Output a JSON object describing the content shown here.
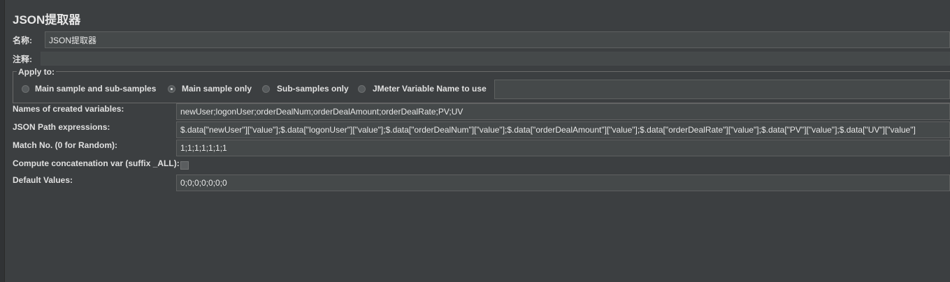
{
  "title": "JSON提取器",
  "name_label": "名称:",
  "name_value": "JSON提取器",
  "comment_label": "注释:",
  "comment_value": "",
  "apply_to": {
    "legend": "Apply to:",
    "options": [
      {
        "label": "Main sample and sub-samples",
        "selected": false
      },
      {
        "label": "Main sample only",
        "selected": true
      },
      {
        "label": "Sub-samples only",
        "selected": false
      },
      {
        "label": "JMeter Variable Name to use",
        "selected": false
      }
    ],
    "variable_name_value": ""
  },
  "fields": {
    "names_label": "Names of created variables:",
    "names_value": "newUser;logonUser;orderDealNum;orderDealAmount;orderDealRate;PV;UV",
    "json_path_label": "JSON Path expressions:",
    "json_path_value": "$.data[\"newUser\"][\"value\"];$.data[\"logonUser\"][\"value\"];$.data[\"orderDealNum\"][\"value\"];$.data[\"orderDealAmount\"][\"value\"];$.data[\"orderDealRate\"][\"value\"];$.data[\"PV\"][\"value\"];$.data[\"UV\"][\"value\"]",
    "match_no_label": "Match No. (0 for Random):",
    "match_no_value": "1;1;1;1;1;1;1",
    "concat_label": "Compute concatenation var (suffix _ALL):",
    "concat_checked": false,
    "default_label": "Default Values:",
    "default_value": "0;0;0;0;0;0;0"
  }
}
